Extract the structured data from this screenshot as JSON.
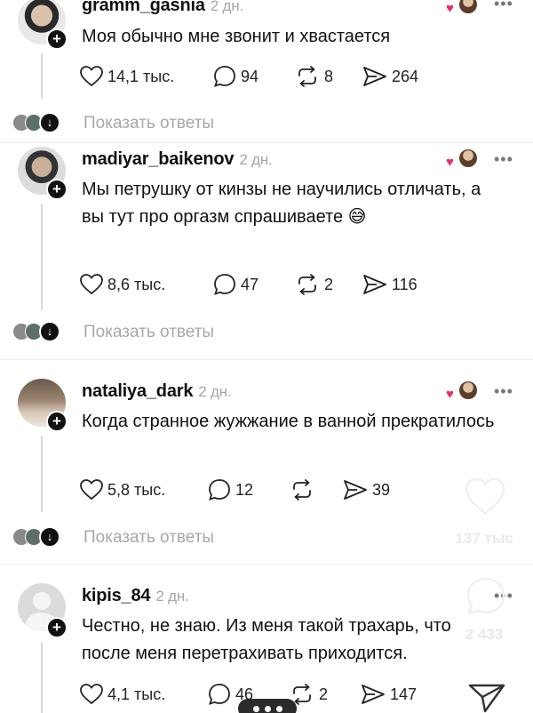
{
  "comments": [
    {
      "username": "gramm_gasnia",
      "time": "2 дн.",
      "text": "Моя обычно мне звонит и хвастается",
      "likes": "14,1 тыс.",
      "replies": "94",
      "reposts": "8",
      "shares": "264"
    },
    {
      "username": "madiyar_baikenov",
      "time": "2 дн.",
      "text": "Мы петрушку от кинзы не научились отличать, а вы тут про оргазм спрашиваете 😅",
      "likes": "8,6 тыс.",
      "replies": "47",
      "reposts": "2",
      "shares": "116"
    },
    {
      "username": "nataliya_dark",
      "time": "2 дн.",
      "text": "Когда странное жужжание в ванной прекратилось",
      "likes": "5,8 тыс.",
      "replies": "12",
      "reposts": "",
      "shares": "39"
    },
    {
      "username": "kipis_84",
      "time": "2 дн.",
      "text": "Честно, не знаю. Из меня такой трахарь, что после меня перетрахивать приходится.",
      "likes": "4,1 тыс.",
      "replies": "46",
      "reposts": "2",
      "shares": "147"
    }
  ],
  "show_replies_label": "Показать ответы",
  "overlay": {
    "likes_count": "137 тыс",
    "comments_count": "2 433"
  },
  "icons": {
    "like": "heart-icon",
    "reply": "speech-bubble-icon",
    "repost": "repost-icon",
    "share": "send-icon",
    "more": "more-dots-icon",
    "follow": "plus-icon"
  },
  "colors": {
    "text": "#111111",
    "muted": "#a8a8a8",
    "accent": "#e1306c"
  }
}
